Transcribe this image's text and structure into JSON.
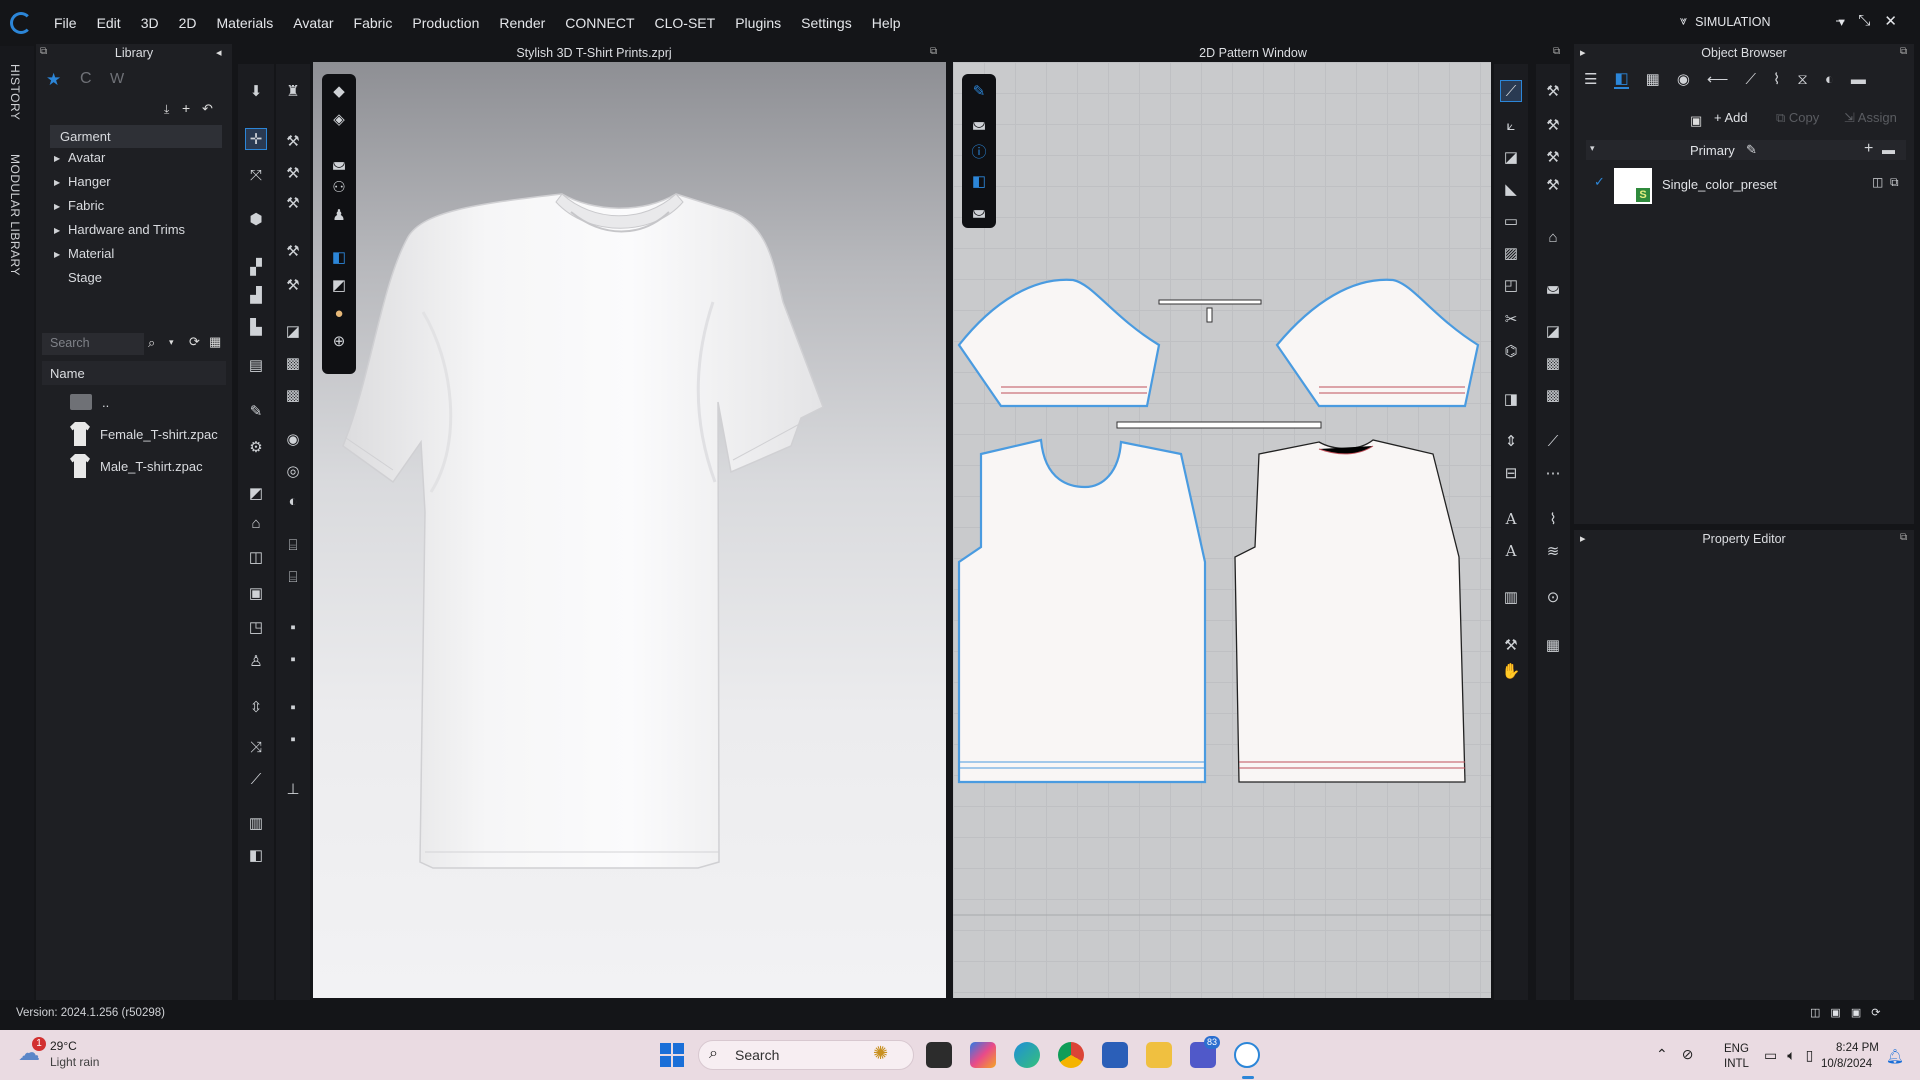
{
  "menubar": {
    "items": [
      "File",
      "Edit",
      "3D",
      "2D",
      "Materials",
      "Avatar",
      "Fabric",
      "Production",
      "Render",
      "CONNECT",
      "CLO-SET",
      "Plugins",
      "Settings",
      "Help"
    ],
    "mode": "SIMULATION"
  },
  "vertical_tabs": {
    "history": "HISTORY",
    "modular_library": "MODULAR LIBRARY"
  },
  "library": {
    "title": "Library",
    "tree": [
      "Garment",
      "Avatar",
      "Hanger",
      "Fabric",
      "Hardware and Trims",
      "Material",
      "Stage"
    ],
    "search_placeholder": "Search",
    "name_header": "Name",
    "files": [
      "..",
      "Female_T-shirt.zpac",
      "Male_T-shirt.zpac"
    ]
  },
  "viewport3d": {
    "title": "Stylish 3D T-Shirt Prints.zprj"
  },
  "pattern2d": {
    "title": "2D Pattern Window"
  },
  "object_browser": {
    "title": "Object Browser",
    "add": "Add",
    "copy": "Copy",
    "assign": "Assign",
    "group": "Primary",
    "preset": "Single_color_preset"
  },
  "property_editor": {
    "title": "Property Editor"
  },
  "status": {
    "version": "Version: 2024.1.256 (r50298)"
  },
  "taskbar": {
    "weather_temp": "29°C",
    "weather_desc": "Light rain",
    "weather_badge": "1",
    "search": "Search",
    "teams_badge": "83",
    "lang1": "ENG",
    "lang2": "INTL",
    "time": "8:24 PM",
    "date": "10/8/2024"
  },
  "colors": {
    "accent": "#2c86d8",
    "pattern_outline": "#4a9be0",
    "seam_red": "#c0505a"
  }
}
